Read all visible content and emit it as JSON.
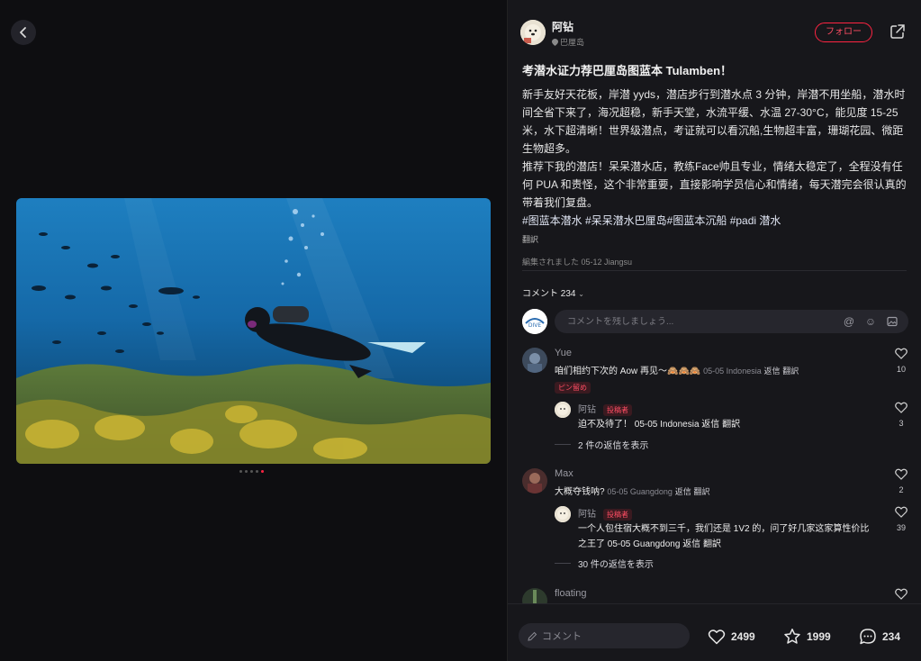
{
  "colors": {
    "accent": "#ff2442",
    "panel_bg": "#17171b",
    "page_bg": "#0e0e11"
  },
  "media": {
    "back_icon": "chevron-left-icon",
    "page_count": 5,
    "active_page": 5
  },
  "author": {
    "name": "阿钻",
    "location": "巴厘岛",
    "follow_label": "フォロー",
    "share_icon": "share-icon"
  },
  "post": {
    "title": "考潜水证力荐巴厘岛图蓝本 Tulamben！",
    "paragraph1": "新手友好天花板，岸潜 yyds，潜店步行到潜水点 3 分钟，岸潜不用坐船，潜水时间全省下来了，海况超稳，新手天堂，水流平缓、水温 27-30°C，能见度 15-25 米，水下超清晰！世界级潜点，考证就可以看沉船,生物超丰富，珊瑚花园、微距生物超多。",
    "paragraph2": "推荐下我的潜店！呆呆潜水店，教练Face帅且专业，情绪太稳定了，全程没有任何 PUA 和责怪，这个非常重要，直接影响学员信心和情绪，每天潜完会很认真的带着我们复盘。",
    "tags": "#图蓝本潜水 #呆呆潜水巴厘岛#图蓝本沉船 #padi 潜水",
    "translate_label": "翻訳",
    "edited_label": "編集されました 05-12 Jiangsu"
  },
  "comments_header": "コメント 234",
  "comment_input": {
    "placeholder": "コメントを残しましょう..."
  },
  "comments": [
    {
      "name": "Yue",
      "text": "咱们相约下次的 Aow 再见～🙈🙈🙈",
      "meta": "05-05 Indonesia",
      "reply_label": "返信",
      "translate_label": "翻訳",
      "likes": "10",
      "pin_label": "ピン留め",
      "reply": {
        "name": "阿钻",
        "author_tag": "投稿者",
        "text": "迫不及待了！",
        "meta": "05-05 Indonesia",
        "reply_label": "返信",
        "translate_label": "翻訳",
        "likes": "3"
      },
      "show_more": "2 件の返信を表示"
    },
    {
      "name": "Max",
      "text": "大概夺钱呐?",
      "meta": "05-05 Guangdong",
      "reply_label": "返信",
      "translate_label": "翻訳",
      "likes": "2",
      "reply": {
        "name": "阿钻",
        "author_tag": "投稿者",
        "text": "一个人包住宿大概不到三千，我们还是 1V2 的，问了好几家这家算性价比之王了",
        "meta": "05-05 Guangdong",
        "reply_label": "返信",
        "translate_label": "翻訳",
        "likes": "39"
      },
      "show_more": "30 件の返信を表示"
    },
    {
      "name": "floating"
    }
  ],
  "bottom_bar": {
    "comment_placeholder": "コメント",
    "likes": "2499",
    "favorites": "1999",
    "comments": "234"
  }
}
